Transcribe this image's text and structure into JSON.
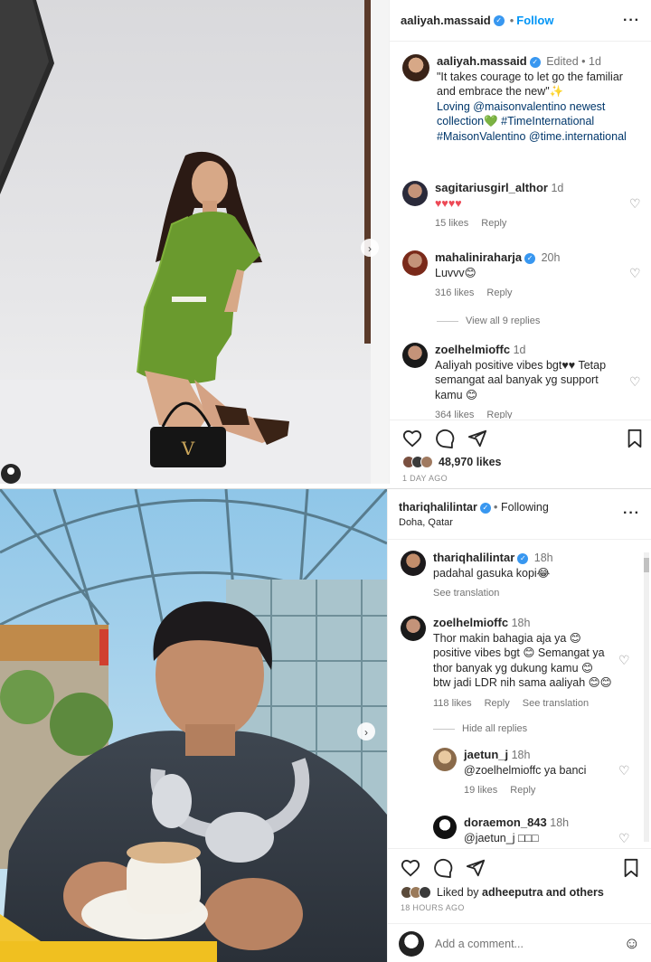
{
  "post1": {
    "username": "aaliyah.massaid",
    "follow_label": "Follow",
    "more": "···",
    "caption_user": "aaliyah.massaid",
    "caption_edited": "Edited",
    "caption_time": "1d",
    "caption_lines": [
      "\"It takes courage to let go the familiar",
      "and embrace the new\"✨",
      "Loving @maisonvalentino newest",
      "collection💚 #TimeInternational",
      "#MaisonValentino @time.international"
    ],
    "comments": [
      {
        "user": "sagitariusgirl_althor",
        "time": "1d",
        "text": "♥♥♥♥",
        "likes": "15 likes",
        "reply": "Reply"
      },
      {
        "user": "mahaliniraharja",
        "time": "20h",
        "text": "Luvvv😊",
        "likes": "316 likes",
        "reply": "Reply",
        "verified": true
      },
      {
        "user": "zoelhelmioffc",
        "time": "1d",
        "text_lines": [
          "Aaliyah positive vibes bgt♥♥ Tetap",
          "semangat aal banyak yg support",
          "kamu 😊"
        ],
        "likes": "364 likes",
        "reply": "Reply"
      }
    ],
    "view_replies": "View all 9 replies",
    "likes_count": "48,970 likes",
    "time_ago": "1 DAY AGO"
  },
  "post2": {
    "username": "thariqhalilintar",
    "following_label": "Following",
    "location": "Doha, Qatar",
    "more": "···",
    "comments": [
      {
        "user": "thariqhalilintar",
        "time": "18h",
        "text": "padahal gasuka kopi😂",
        "see_translation": "See translation"
      },
      {
        "user": "zoelhelmioffc",
        "time": "18h",
        "text_lines": [
          "Thor makin bahagia aja ya 😊",
          "positive vibes bgt 😊 Semangat ya",
          "thor banyak yg dukung kamu 😊",
          "btw jadi LDR nih sama aaliyah 😊😊"
        ],
        "likes": "118 likes",
        "reply": "Reply",
        "see_translation": "See translation"
      },
      {
        "user": "jaetun_j",
        "time": "18h",
        "text": "@zoelhelmioffc ya banci",
        "likes": "19 likes",
        "reply": "Reply"
      },
      {
        "user": "doraemon_843",
        "time": "18h",
        "text": "@jaetun_j □□□"
      }
    ],
    "hide_replies": "Hide all replies",
    "liked_by_prefix": "Liked by ",
    "liked_by_user": "adheeputra",
    "liked_by_suffix": " and others",
    "time_ago": "18 HOURS AGO",
    "add_comment_placeholder": "Add a comment..."
  },
  "colors": {
    "accent": "#0095f6",
    "verified": "#3897f0",
    "dress": "#6a9a2e"
  }
}
